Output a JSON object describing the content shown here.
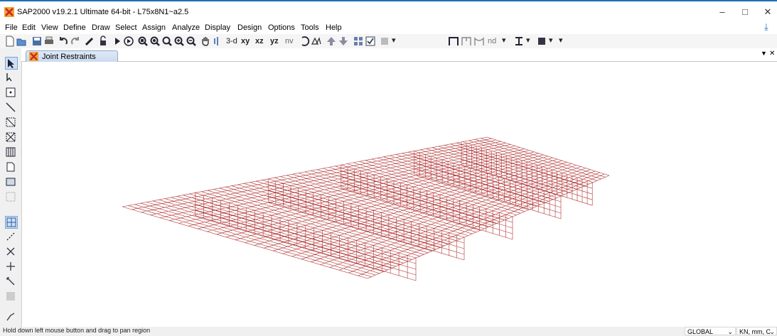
{
  "window": {
    "title": "SAP2000 v19.2.1 Ultimate 64-bit - L75x8N1~a2.5",
    "minimize": "–",
    "maximize": "□",
    "close": "✕"
  },
  "menu": [
    "File",
    "Edit",
    "View",
    "Define",
    "Draw",
    "Select",
    "Assign",
    "Analyze",
    "Display",
    "Design",
    "Options",
    "Tools",
    "Help"
  ],
  "toolbar": {
    "view_3d": "3-d",
    "view_xy": "xy",
    "view_xz": "xz",
    "view_yz": "yz",
    "view_nv": "nv",
    "nd_label": "nd"
  },
  "tab": {
    "label": "Joint Restraints",
    "close": "✕"
  },
  "status": {
    "message": "Hold down left mouse button and drag to pan region",
    "coord_system": "GLOBAL",
    "units": "KN, mm, C"
  },
  "colors": {
    "mesh": "#b03030",
    "accent": "#1d6fb8"
  }
}
